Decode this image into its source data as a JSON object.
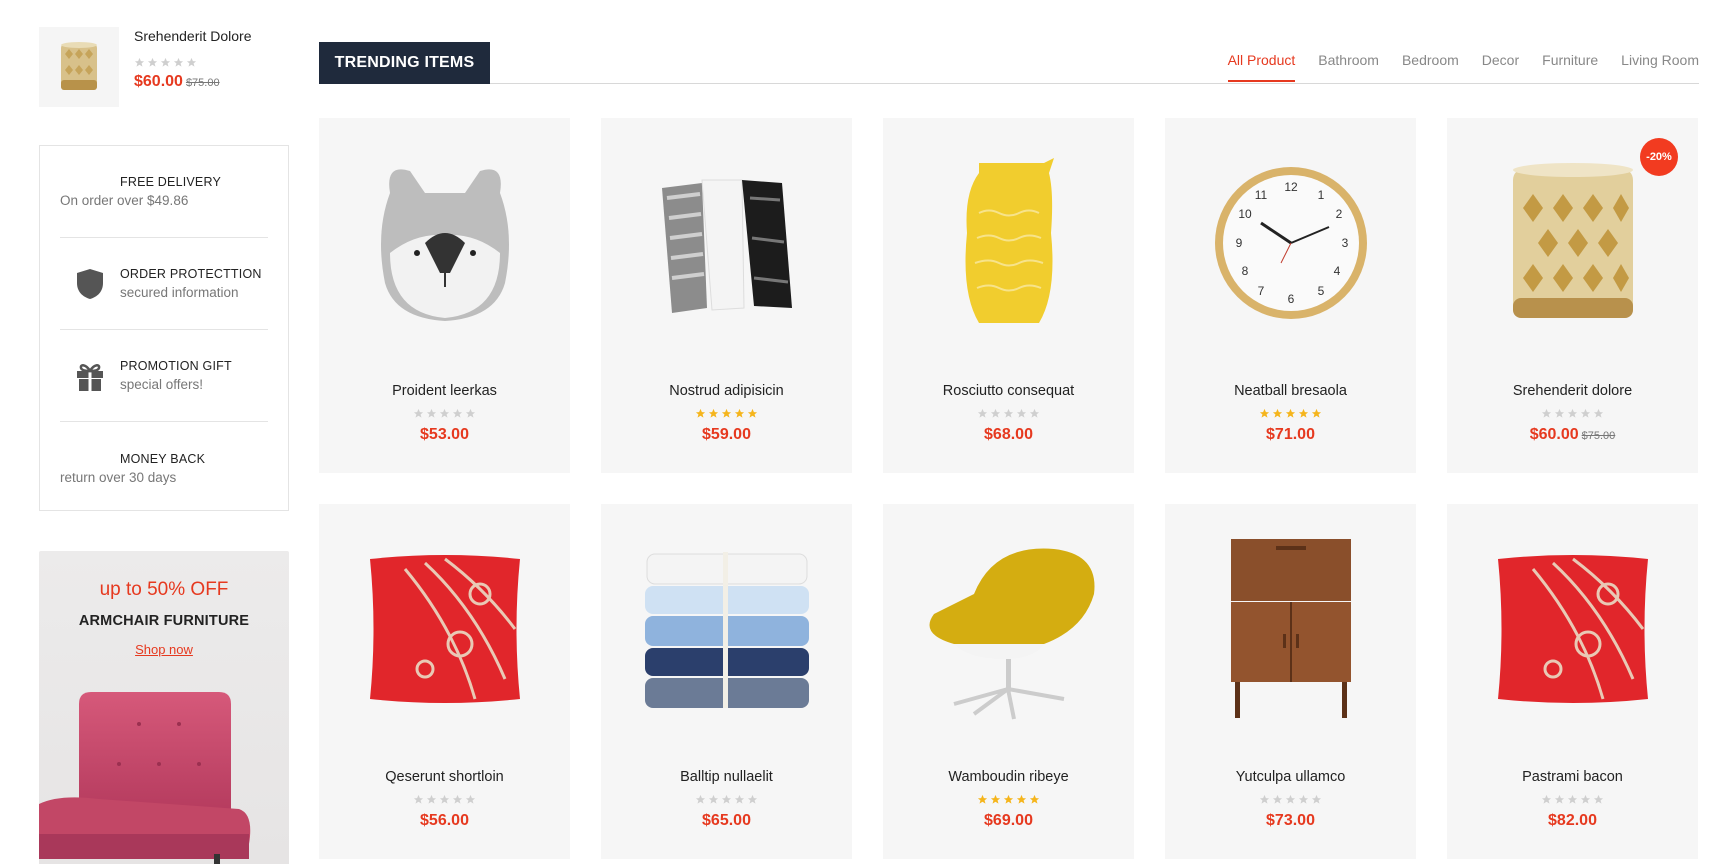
{
  "mini_product": {
    "name": "Srehenderit Dolore",
    "rating": 0,
    "price": "$60.00",
    "old_price": "$75.00"
  },
  "services": [
    {
      "title": "FREE DELIVERY",
      "subtitle": "On order over $49.86",
      "icon": "none"
    },
    {
      "title": "ORDER PROTECTTION",
      "subtitle": "secured information",
      "icon": "shield-icon"
    },
    {
      "title": "PROMOTION GIFT",
      "subtitle": "special offers!",
      "icon": "gift-icon"
    },
    {
      "title": "MONEY BACK",
      "subtitle": "return over 30 days",
      "icon": "none"
    }
  ],
  "banner": {
    "discount": "up to 50% OFF",
    "title": "ARMCHAIR FURNITURE",
    "link": "Shop now"
  },
  "section": {
    "title": "TRENDING ITEMS"
  },
  "tabs": [
    {
      "label": "All Product",
      "active": true
    },
    {
      "label": "Bathroom",
      "active": false
    },
    {
      "label": "Bedroom",
      "active": false
    },
    {
      "label": "Decor",
      "active": false
    },
    {
      "label": "Furniture",
      "active": false
    },
    {
      "label": "Living Room",
      "active": false
    }
  ],
  "products": [
    {
      "name": "Proident leerkas",
      "price": "$53.00",
      "old_price": "",
      "rating": 0,
      "image": "dog-pillow",
      "badge": ""
    },
    {
      "name": "Nostrud adipisicin",
      "price": "$59.00",
      "old_price": "",
      "rating": 5,
      "image": "hanging-towels",
      "badge": ""
    },
    {
      "name": "Rosciutto consequat",
      "price": "$68.00",
      "old_price": "",
      "rating": 0,
      "image": "yellow-vase",
      "badge": ""
    },
    {
      "name": "Neatball bresaola",
      "price": "$71.00",
      "old_price": "",
      "rating": 5,
      "image": "wall-clock",
      "badge": ""
    },
    {
      "name": "Srehenderit dolore",
      "price": "$60.00",
      "old_price": "$75.00",
      "rating": 0,
      "image": "mosaic-candle",
      "badge": "-20%"
    },
    {
      "name": "Qeserunt shortloin",
      "price": "$56.00",
      "old_price": "",
      "rating": 0,
      "image": "red-pillow",
      "badge": ""
    },
    {
      "name": "Balltip nullaelit",
      "price": "$65.00",
      "old_price": "",
      "rating": 0,
      "image": "towel-stack",
      "badge": ""
    },
    {
      "name": "Wamboudin ribeye",
      "price": "$69.00",
      "old_price": "",
      "rating": 5,
      "image": "yellow-chair",
      "badge": ""
    },
    {
      "name": "Yutculpa ullamco",
      "price": "$73.00",
      "old_price": "",
      "rating": 0,
      "image": "wood-cabinet",
      "badge": ""
    },
    {
      "name": "Pastrami bacon",
      "price": "$82.00",
      "old_price": "",
      "rating": 0,
      "image": "red-pillow",
      "badge": ""
    }
  ],
  "colors": {
    "accent": "#e6391f",
    "star_filled": "#f5b51c",
    "star_empty": "#cfcfcf",
    "title_bg": "#1f2a3c"
  }
}
